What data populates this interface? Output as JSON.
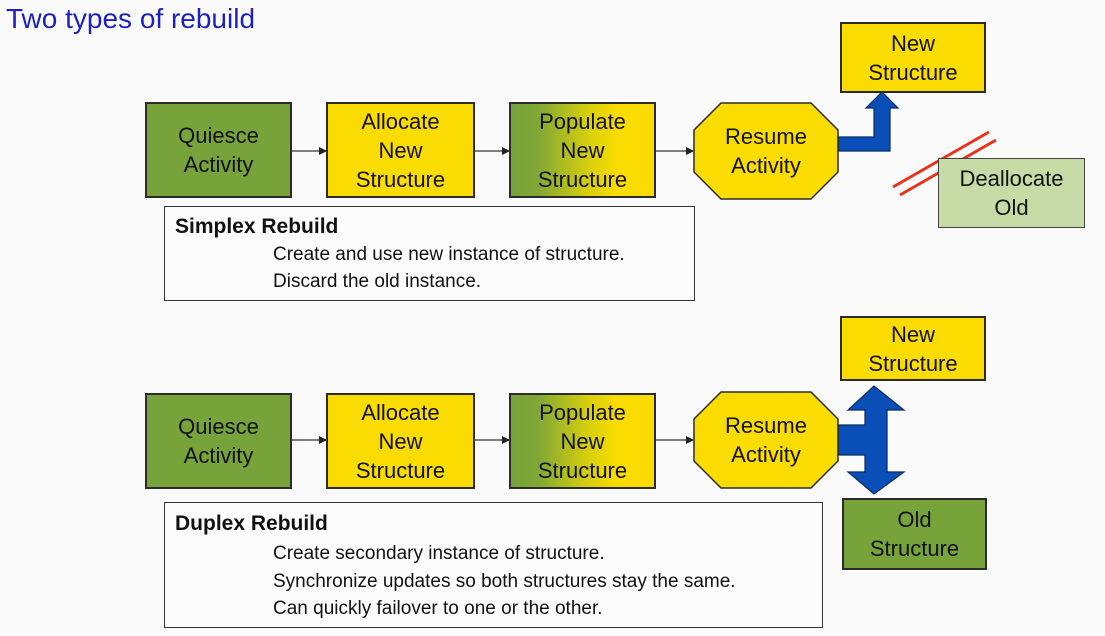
{
  "title": "Two types of rebuild",
  "colors": {
    "title": "#1f1fbf",
    "green": "#77a33a",
    "yellow": "#fbdc00",
    "pale_green": "#c6dba6",
    "arrow_blue": "#0a4fb8",
    "strike_red": "#e8321e"
  },
  "simplex": {
    "steps": [
      {
        "label": "Quiesce\nActivity"
      },
      {
        "label": "Allocate\nNew\nStructure"
      },
      {
        "label": "Populate\nNew\nStructure"
      },
      {
        "label": "Resume\nActivity"
      }
    ],
    "new_structure": "New\nStructure",
    "deallocate_old": "Deallocate\nOld",
    "description": {
      "heading": "Simplex Rebuild",
      "lines": [
        "Create and use new instance of structure.",
        "Discard the old instance."
      ]
    }
  },
  "duplex": {
    "steps": [
      {
        "label": "Quiesce\nActivity"
      },
      {
        "label": "Allocate\nNew\nStructure"
      },
      {
        "label": "Populate\nNew\nStructure"
      },
      {
        "label": "Resume\nActivity"
      }
    ],
    "new_structure": "New\nStructure",
    "old_structure": "Old\nStructure",
    "description": {
      "heading": "Duplex Rebuild",
      "lines": [
        "Create secondary instance of structure.",
        "Synchronize updates so both structures stay the same.",
        "Can quickly failover to one or the other."
      ]
    }
  }
}
